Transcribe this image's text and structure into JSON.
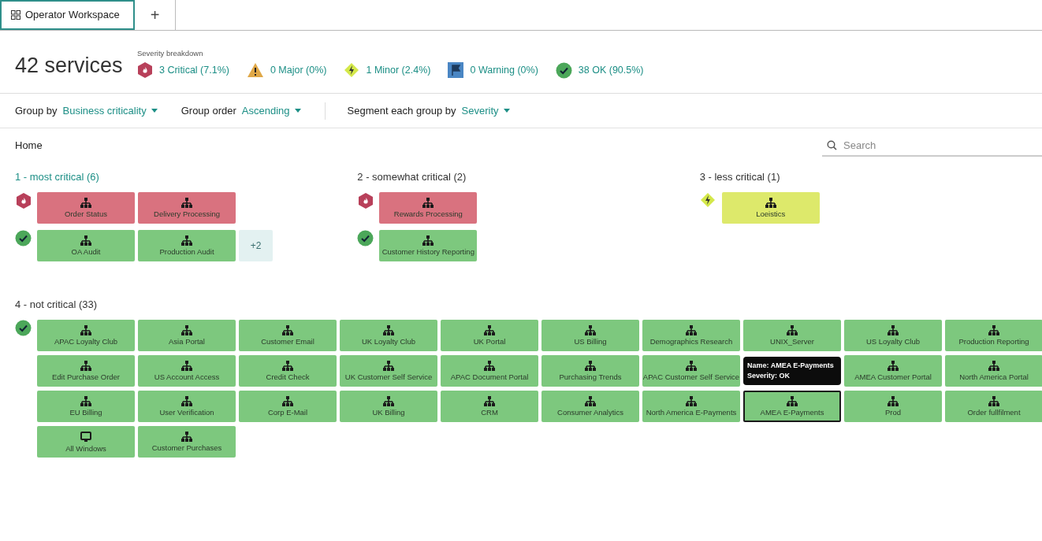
{
  "tabs": [
    {
      "label": "Operator Workspace",
      "selected": true
    }
  ],
  "add_tab": "+",
  "header": {
    "title": "42 services",
    "breakdown_label": "Severity breakdown",
    "breakdown": [
      {
        "kind": "critical",
        "label": "3 Critical (7.1%)"
      },
      {
        "kind": "major",
        "label": "0 Major (0%)"
      },
      {
        "kind": "minor",
        "label": "1 Minor (2.4%)"
      },
      {
        "kind": "warning",
        "label": "0 Warning (0%)"
      },
      {
        "kind": "ok",
        "label": "38 OK (90.5%)"
      }
    ]
  },
  "toolbar": [
    {
      "label": "Group by",
      "value": "Business criticality"
    },
    {
      "label": "Group order",
      "value": "Ascending"
    },
    {
      "label": "Segment each group by",
      "value": "Severity"
    }
  ],
  "breadcrumb": "Home",
  "search": {
    "placeholder": "Search"
  },
  "groups": [
    {
      "title": "1 - most critical (6)",
      "selected": true,
      "rows": [
        {
          "kind": "critical",
          "tiles": [
            {
              "kind": "service",
              "label": "Order Status",
              "hovered": false
            },
            {
              "kind": "service",
              "label": "Delivery Processing",
              "hovered": false
            }
          ]
        },
        {
          "kind": "ok",
          "tiles": [
            {
              "kind": "service",
              "label": "OA Audit",
              "hovered": false
            },
            {
              "kind": "service",
              "label": "Production Audit",
              "hovered": false
            }
          ],
          "more": "+2"
        }
      ]
    },
    {
      "title": "2 - somewhat critical (2)",
      "selected": false,
      "rows": [
        {
          "kind": "critical",
          "tiles": [
            {
              "kind": "service",
              "label": "Rewards Processing",
              "hovered": false
            }
          ]
        },
        {
          "kind": "ok",
          "tiles": [
            {
              "kind": "service",
              "label": "Customer History Reporting",
              "hovered": false
            }
          ]
        }
      ]
    },
    {
      "title": "3 - less critical (1)",
      "selected": false,
      "rows": [
        {
          "kind": "minor",
          "tiles": [
            {
              "kind": "service",
              "label": "Loeistics",
              "hovered": false
            }
          ]
        }
      ]
    }
  ],
  "big_group": {
    "title": "4 - not critical (33)",
    "selected": false,
    "kind": "ok",
    "tiles": [
      {
        "kind": "service",
        "label": "APAC Loyalty Club",
        "hovered": false
      },
      {
        "kind": "service",
        "label": "Asia Portal",
        "hovered": false
      },
      {
        "kind": "service",
        "label": "Customer Email",
        "hovered": false
      },
      {
        "kind": "service",
        "label": "UK Loyalty Club",
        "hovered": false
      },
      {
        "kind": "service",
        "label": "UK Portal",
        "hovered": false
      },
      {
        "kind": "service",
        "label": "US Billing",
        "hovered": false
      },
      {
        "kind": "service",
        "label": "Demographics Research",
        "hovered": false
      },
      {
        "kind": "service",
        "label": "UNIX_Server",
        "hovered": false
      },
      {
        "kind": "service",
        "label": "US Loyalty Club",
        "hovered": false
      },
      {
        "kind": "service",
        "label": "Production Reporting",
        "hovered": false
      },
      {
        "kind": "service",
        "label": "Edit Purchase Order",
        "hovered": false
      },
      {
        "kind": "service",
        "label": "US Account Access",
        "hovered": false
      },
      {
        "kind": "service",
        "label": "Credit Check",
        "hovered": false
      },
      {
        "kind": "service",
        "label": "UK Customer Self Service",
        "hovered": false
      },
      {
        "kind": "service",
        "label": "APAC Document Portal",
        "hovered": false
      },
      {
        "kind": "service",
        "label": "Purchasing Trends",
        "hovered": false
      },
      {
        "kind": "service",
        "label": "APAC Customer Self Service",
        "hovered": false
      },
      {
        "kind": "tooltip",
        "lines": [
          "Name: AMEA E-Payments",
          "Severity: OK"
        ]
      },
      {
        "kind": "service",
        "label": "AMEA Customer Portal",
        "hovered": false
      },
      {
        "kind": "service",
        "label": "North America Portal",
        "hovered": false
      },
      {
        "kind": "service",
        "label": "EU Billing",
        "hovered": false
      },
      {
        "kind": "service",
        "label": "User Verification",
        "hovered": false
      },
      {
        "kind": "service",
        "label": "Corp E-Mail",
        "hovered": false
      },
      {
        "kind": "service",
        "label": "UK Billing",
        "hovered": false
      },
      {
        "kind": "service",
        "label": "CRM",
        "hovered": false
      },
      {
        "kind": "service",
        "label": "Consumer Analytics",
        "hovered": false
      },
      {
        "kind": "service",
        "label": "North America E-Payments",
        "hovered": false
      },
      {
        "kind": "service",
        "label": "AMEA E-Payments",
        "hovered": true
      },
      {
        "kind": "service",
        "label": "Prod",
        "hovered": false
      },
      {
        "kind": "service",
        "label": "Order fullfilment",
        "hovered": false
      },
      {
        "kind": "host",
        "label": "All Windows",
        "hovered": false
      },
      {
        "kind": "service",
        "label": "Customer Purchases",
        "hovered": false
      }
    ]
  }
}
